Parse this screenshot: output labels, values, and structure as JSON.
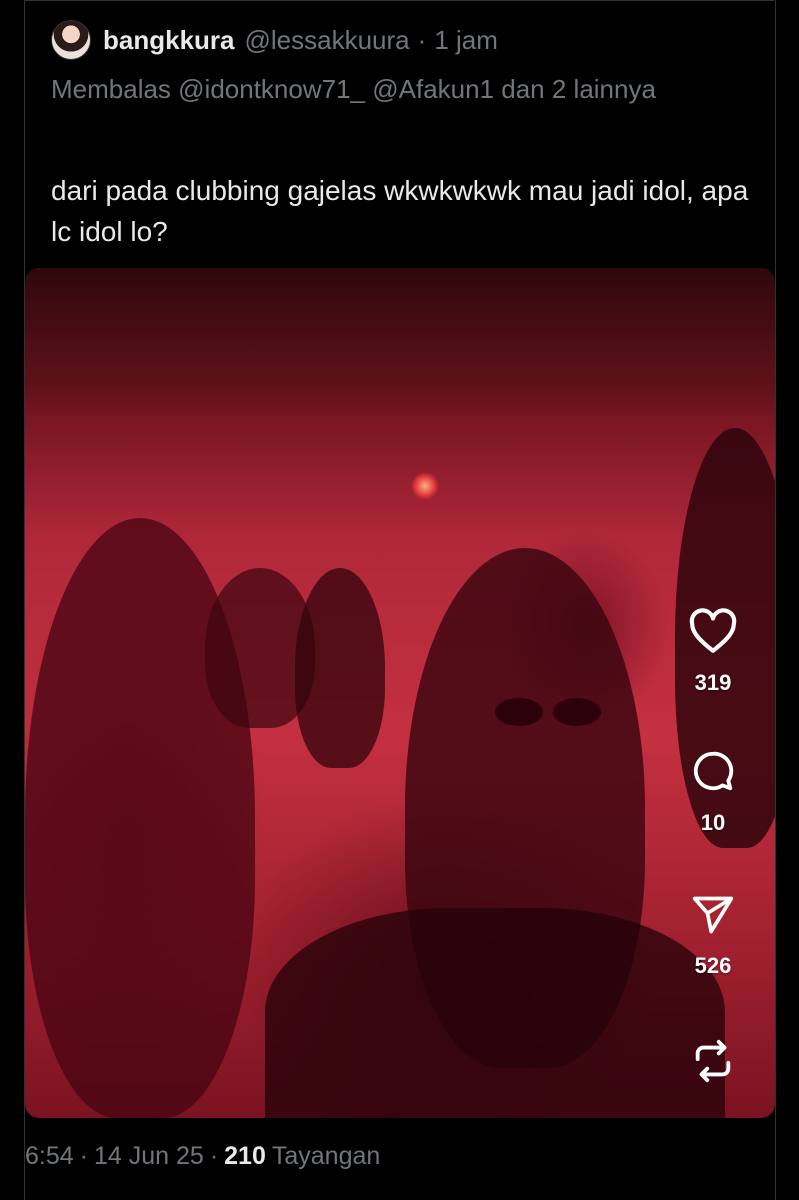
{
  "tweet": {
    "display_name": "bangkkura",
    "handle": "@lessakkuura",
    "separator": "·",
    "time_ago": "1 jam",
    "reply_line": "Membalas @idontknow71_ @Afakun1 dan 2 lainnya",
    "text": "dari pada clubbing gajelas wkwkwkwk mau jadi idol, apa lc idol lo?"
  },
  "video_actions": {
    "likes": "319",
    "comments": "10",
    "shares": "526",
    "repost_icon": "repost-icon",
    "like_icon": "heart-icon",
    "comment_icon": "comment-icon",
    "share_icon": "send-icon"
  },
  "footer": {
    "time": "6:54",
    "date": "14 Jun 25",
    "views_count": "210",
    "views_label": "Tayangan",
    "separator": "·"
  },
  "colors": {
    "background": "#000000",
    "text_primary": "#e7e9ea",
    "text_secondary": "#71767b",
    "media_tint": "#c4303f"
  }
}
